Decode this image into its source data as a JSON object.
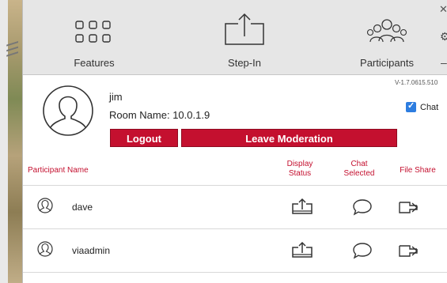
{
  "toolbar": {
    "items": [
      {
        "label": "Features",
        "icon": "grid-icon"
      },
      {
        "label": "Step-In",
        "icon": "upload-screen-icon"
      },
      {
        "label": "Participants",
        "icon": "participants-icon"
      }
    ]
  },
  "user": {
    "name": "jim",
    "room_label": "Room Name: 10.0.1.9",
    "version": "V-1.7.0615.510",
    "chat_label": "Chat",
    "chat_checked": true,
    "logout_label": "Logout",
    "leave_label": "Leave Moderation"
  },
  "columns": {
    "name": "Participant Name",
    "display_status": "Display Status",
    "chat_selected": "Chat Selected",
    "file_share": "File Share"
  },
  "participants": [
    {
      "name": "dave"
    },
    {
      "name": "viaadmin"
    }
  ],
  "colors": {
    "accent": "#c4102f",
    "checkbox": "#2d7de0",
    "toolbar_bg": "#e6e6e6"
  }
}
